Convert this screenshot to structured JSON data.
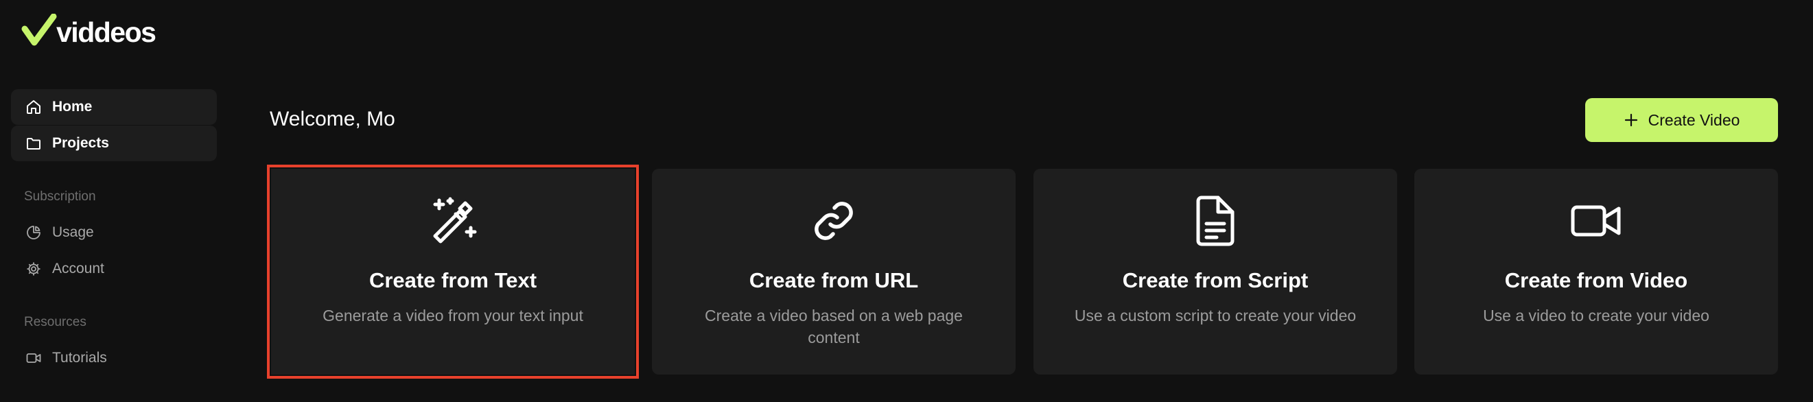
{
  "app": {
    "brand": "viddeos",
    "accent_color": "#c6f46b",
    "selection_color": "#e8412c"
  },
  "sidebar": {
    "main_items": [
      {
        "label": "Home",
        "icon": "home-icon"
      },
      {
        "label": "Projects",
        "icon": "folder-icon"
      }
    ],
    "subscription": {
      "title": "Subscription",
      "items": [
        {
          "label": "Usage",
          "icon": "pie-chart-icon"
        },
        {
          "label": "Account",
          "icon": "gear-icon"
        }
      ]
    },
    "resources": {
      "title": "Resources",
      "items": [
        {
          "label": "Tutorials",
          "icon": "video-camera-icon"
        }
      ]
    }
  },
  "main": {
    "welcome": "Welcome, Mo",
    "create_button": {
      "label": "Create Video",
      "icon": "plus-icon"
    },
    "cards": [
      {
        "title": "Create from Text",
        "description": "Generate a video from your text input",
        "icon": "magic-wand-icon",
        "selected": true
      },
      {
        "title": "Create from URL",
        "description": "Create a video based on a web page content",
        "icon": "link-icon",
        "selected": false
      },
      {
        "title": "Create from Script",
        "description": "Use a custom script to create your video",
        "icon": "document-icon",
        "selected": false
      },
      {
        "title": "Create from Video",
        "description": "Use a video to create your video",
        "icon": "video-camera-icon",
        "selected": false
      }
    ]
  }
}
